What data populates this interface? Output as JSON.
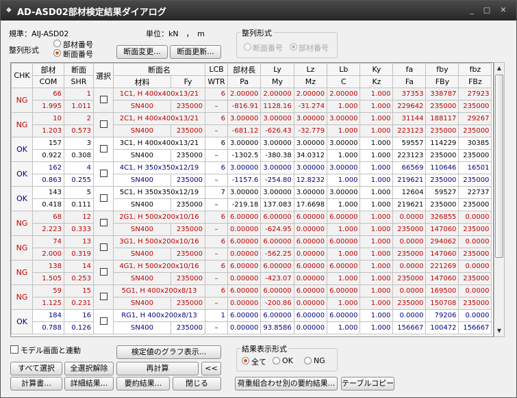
{
  "window": {
    "title": "AD-ASD02部材検定結果ダイアログ"
  },
  "top": {
    "standard_label": "規準：AIJ-ASD02",
    "unit_label": "単位：kN　，　m",
    "sort_label": "整列形式",
    "sort_opt1": "部材番号",
    "sort_opt2": "断面番号",
    "sort_selected": "断面番号",
    "btn_section_change": "断面変更...",
    "btn_section_update": "断面更新...",
    "sort_group_title": "整列形式",
    "sort_group_opt1": "断面番号",
    "sort_group_opt2": "部材番号"
  },
  "grid": {
    "header1": [
      "CHK",
      "部材",
      "断面",
      "選択",
      "断面名",
      "LCB",
      "部材長",
      "Ly",
      "Lz",
      "Lb",
      "Ky",
      "fa",
      "fby",
      "fbz"
    ],
    "header2": [
      "COM",
      "SHR",
      "材料",
      "Fy",
      "WTR",
      "Pa",
      "My",
      "Mz",
      "C",
      "Kz",
      "Fa",
      "FBy",
      "FBz"
    ],
    "rows": [
      {
        "chk": "NG",
        "member": "66",
        "sec": "1",
        "name": "1C1, H 400x400x13/21",
        "lcb": "6",
        "len": "2.00000",
        "ly": "2.00000",
        "lz": "2.00000",
        "lb": "2.00000",
        "ky": "1.000",
        "fa": "37353",
        "fby": "338787",
        "fbz": "27923",
        "com": "1.995",
        "shr": "1.011",
        "mat": "SN400",
        "fy": "235000",
        "wtr": "–",
        "pa": "-816.91",
        "my": "1128.16",
        "mz": "-31.274",
        "c": "1.000",
        "kz": "1.000",
        "Fa": "229642",
        "FBy": "235000",
        "FBz": "235000"
      },
      {
        "chk": "NG",
        "member": "10",
        "sec": "2",
        "name": "2C1, H 400x400x13/21",
        "lcb": "6",
        "len": "3.00000",
        "ly": "3.00000",
        "lz": "3.00000",
        "lb": "3.00000",
        "ky": "1.000",
        "fa": "31144",
        "fby": "188117",
        "fbz": "29267",
        "com": "1.203",
        "shr": "0.573",
        "mat": "SN400",
        "fy": "235000",
        "wtr": "–",
        "pa": "-681.12",
        "my": "-626.43",
        "mz": "-32.779",
        "c": "1.000",
        "kz": "1.000",
        "Fa": "223123",
        "FBy": "235000",
        "FBz": "235000"
      },
      {
        "chk": "OK",
        "member": "157",
        "sec": "3",
        "name": "3C1, H 400x400x13/21",
        "lcb": "6",
        "len": "3.00000",
        "ly": "3.00000",
        "lz": "3.00000",
        "lb": "3.00000",
        "ky": "1.000",
        "fa": "59557",
        "fby": "114229",
        "fbz": "30385",
        "com": "0.922",
        "shr": "0.308",
        "mat": "SN400",
        "fy": "235000",
        "wtr": "–",
        "pa": "-1302.5",
        "my": "-380.38",
        "mz": "34.0312",
        "c": "1.000",
        "kz": "1.000",
        "Fa": "223123",
        "FBy": "235000",
        "FBz": "235000"
      },
      {
        "chk": "OK",
        "member": "162",
        "sec": "4",
        "name": "4C1, H 350x350x12/19",
        "lcb": "6",
        "len": "3.00000",
        "ly": "3.00000",
        "lz": "3.00000",
        "lb": "3.00000",
        "ky": "1.000",
        "fa": "66569",
        "fby": "110646",
        "fbz": "16501",
        "com": "0.863",
        "shr": "0.255",
        "mat": "SN400",
        "fy": "235000",
        "wtr": "–",
        "pa": "-1157.6",
        "my": "-254.80",
        "mz": "12.8232",
        "c": "1.000",
        "kz": "1.000",
        "Fa": "219621",
        "FBy": "235000",
        "FBz": "235000"
      },
      {
        "chk": "OK",
        "member": "143",
        "sec": "5",
        "name": "5C1, H 350x350x12/19",
        "lcb": "7",
        "len": "3.00000",
        "ly": "3.00000",
        "lz": "3.00000",
        "lb": "3.00000",
        "ky": "1.000",
        "fa": "12604",
        "fby": "59527",
        "fbz": "22737",
        "com": "0.418",
        "shr": "0.111",
        "mat": "SN400",
        "fy": "235000",
        "wtr": "–",
        "pa": "-219.18",
        "my": "137.083",
        "mz": "17.6698",
        "c": "1.000",
        "kz": "1.000",
        "Fa": "219621",
        "FBy": "235000",
        "FBz": "235000"
      },
      {
        "chk": "NG",
        "member": "68",
        "sec": "12",
        "name": "2G1, H 500x200x10/16",
        "lcb": "6",
        "len": "6.00000",
        "ly": "6.00000",
        "lz": "6.00000",
        "lb": "6.00000",
        "ky": "1.000",
        "fa": "0.0000",
        "fby": "326855",
        "fbz": "0.0000",
        "com": "2.223",
        "shr": "0.333",
        "mat": "SN400",
        "fy": "235000",
        "wtr": "–",
        "pa": "0.00000",
        "my": "-624.95",
        "mz": "0.00000",
        "c": "1.000",
        "kz": "1.000",
        "Fa": "235000",
        "FBy": "147060",
        "FBz": "235000"
      },
      {
        "chk": "NG",
        "member": "74",
        "sec": "13",
        "name": "3G1, H 500x200x10/16",
        "lcb": "6",
        "len": "6.00000",
        "ly": "6.00000",
        "lz": "6.00000",
        "lb": "6.00000",
        "ky": "1.000",
        "fa": "0.0000",
        "fby": "294062",
        "fbz": "0.0000",
        "com": "2.000",
        "shr": "0.319",
        "mat": "SN400",
        "fy": "235000",
        "wtr": "–",
        "pa": "0.00000",
        "my": "-562.25",
        "mz": "0.00000",
        "c": "1.000",
        "kz": "1.000",
        "Fa": "235000",
        "FBy": "147060",
        "FBz": "235000"
      },
      {
        "chk": "NG",
        "member": "138",
        "sec": "14",
        "name": "4G1, H 500x200x10/16",
        "lcb": "6",
        "len": "6.00000",
        "ly": "6.00000",
        "lz": "6.00000",
        "lb": "6.00000",
        "ky": "1.000",
        "fa": "0.0000",
        "fby": "221269",
        "fbz": "0.0000",
        "com": "1.505",
        "shr": "0.253",
        "mat": "SN400",
        "fy": "235000",
        "wtr": "–",
        "pa": "0.00000",
        "my": "-423.07",
        "mz": "0.00000",
        "c": "1.000",
        "kz": "1.000",
        "Fa": "235000",
        "FBy": "147060",
        "FBz": "235000"
      },
      {
        "chk": "NG",
        "member": "59",
        "sec": "15",
        "name": "5G1, H 400x200x8/13",
        "lcb": "6",
        "len": "6.00000",
        "ly": "6.00000",
        "lz": "6.00000",
        "lb": "6.00000",
        "ky": "1.000",
        "fa": "0.0000",
        "fby": "169500",
        "fbz": "0.0000",
        "com": "1.125",
        "shr": "0.231",
        "mat": "SN400",
        "fy": "235000",
        "wtr": "–",
        "pa": "0.00000",
        "my": "-200.86",
        "mz": "0.00000",
        "c": "1.000",
        "kz": "1.000",
        "Fa": "235000",
        "FBy": "150708",
        "FBz": "235000"
      },
      {
        "chk": "OK",
        "member": "184",
        "sec": "16",
        "name": "RG1, H 400x200x8/13",
        "lcb": "1",
        "len": "6.00000",
        "ly": "6.00000",
        "lz": "6.00000",
        "lb": "6.00000",
        "ky": "1.000",
        "fa": "0.0000",
        "fby": "79206",
        "fbz": "0.0000",
        "com": "0.788",
        "shr": "0.126",
        "mat": "SN400",
        "fy": "235000",
        "wtr": "–",
        "pa": "0.00000",
        "my": "93.8586",
        "mz": "0.00000",
        "c": "1.000",
        "kz": "1.000",
        "Fa": "156667",
        "FBy": "100472",
        "FBz": "156667"
      }
    ]
  },
  "bottom": {
    "model_link": "モデル画面と連動",
    "btn_graph": "検定値のグラフ表示...",
    "result_group_title": "結果表示形式",
    "result_all": "全て",
    "result_ok": "OK",
    "result_ng": "NG",
    "btn_select_all": "すべて選択",
    "btn_deselect_all": "全選択解除",
    "btn_recalc": "再計算",
    "btn_back": "<<",
    "btn_calc_doc": "計算書...",
    "btn_detail": "詳細結果...",
    "btn_summary": "要約結果...",
    "btn_close": "閉じる",
    "btn_load_comb_summary": "荷重組合わせ別の要約結果...",
    "btn_table_copy": "テーブルコピー"
  },
  "colors": {
    "ng": "#c00000",
    "ok_text": "#000000",
    "ok_blue": "#000080",
    "title_bg": "#333333",
    "radio_on": "#e05a1a"
  }
}
